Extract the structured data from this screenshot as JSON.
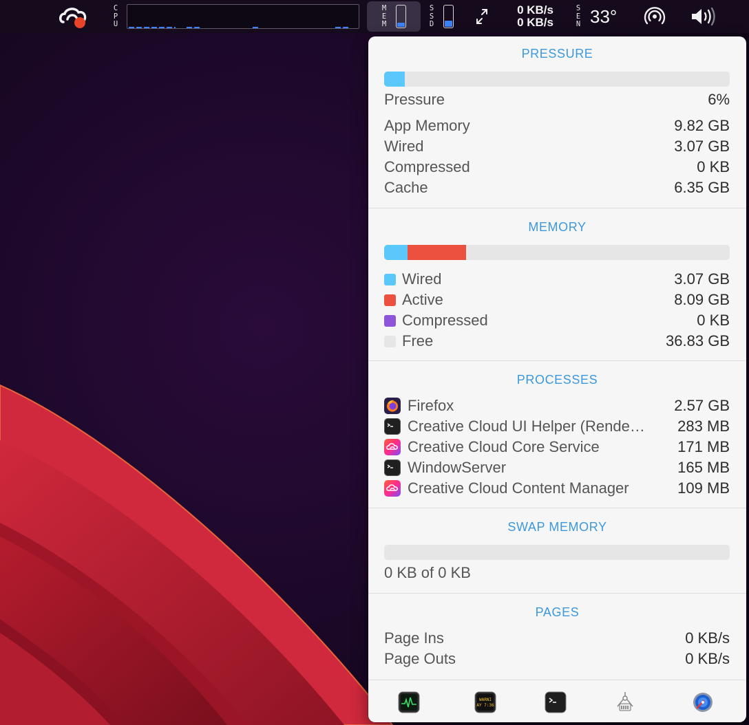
{
  "menubar": {
    "cpu_label": [
      "C",
      "P",
      "U"
    ],
    "mem_label": [
      "M",
      "E",
      "M"
    ],
    "ssd_label": [
      "S",
      "S",
      "D"
    ],
    "sen_label": [
      "S",
      "E",
      "N"
    ],
    "mem_usage_fraction": 0.2,
    "ssd_usage_fraction": 0.3,
    "network": {
      "upload": "0 KB/s",
      "download": "0 KB/s"
    },
    "temperature": "33°"
  },
  "pressure": {
    "title": "PRESSURE",
    "level_fraction": 0.06,
    "pressure_label": "Pressure",
    "pressure_value": "6%",
    "rows": [
      {
        "label": "App Memory",
        "value": "9.82 GB"
      },
      {
        "label": "Wired",
        "value": "3.07 GB"
      },
      {
        "label": "Compressed",
        "value": "0 KB"
      },
      {
        "label": "Cache",
        "value": "6.35 GB"
      }
    ]
  },
  "memory": {
    "title": "MEMORY",
    "bar_fractions": {
      "wired": 0.068,
      "active": 0.17
    },
    "legend": [
      {
        "label": "Wired",
        "value": "3.07 GB",
        "color": "#5ac8fa"
      },
      {
        "label": "Active",
        "value": "8.09 GB",
        "color": "#ec5140"
      },
      {
        "label": "Compressed",
        "value": "0 KB",
        "color": "#8e55d9"
      },
      {
        "label": "Free",
        "value": "36.83 GB",
        "color": "#e6e6e6"
      }
    ]
  },
  "processes": {
    "title": "PROCESSES",
    "items": [
      {
        "name": "Firefox",
        "value": "2.57 GB",
        "icon": "firefox-icon"
      },
      {
        "name": "Creative Cloud UI Helper (Renderer)",
        "value": "283 MB",
        "icon": "terminal-icon"
      },
      {
        "name": "Creative Cloud Core Service",
        "value": "171 MB",
        "icon": "creative-cloud-icon"
      },
      {
        "name": "WindowServer",
        "value": "165 MB",
        "icon": "terminal-icon"
      },
      {
        "name": "Creative Cloud Content Manager",
        "value": "109 MB",
        "icon": "creative-cloud-icon"
      }
    ]
  },
  "swap": {
    "title": "SWAP MEMORY",
    "usage_fraction": 0,
    "summary": "0 KB of 0 KB"
  },
  "pages": {
    "title": "PAGES",
    "rows": [
      {
        "label": "Page Ins",
        "value": "0 KB/s"
      },
      {
        "label": "Page Outs",
        "value": "0 KB/s"
      }
    ]
  },
  "toolbar": {
    "buttons": [
      "activity-monitor-icon",
      "console-icon",
      "terminal-icon",
      "system-information-icon",
      "disk-utility-icon"
    ],
    "console_text": [
      "WARNI",
      "AY 7:36"
    ]
  }
}
